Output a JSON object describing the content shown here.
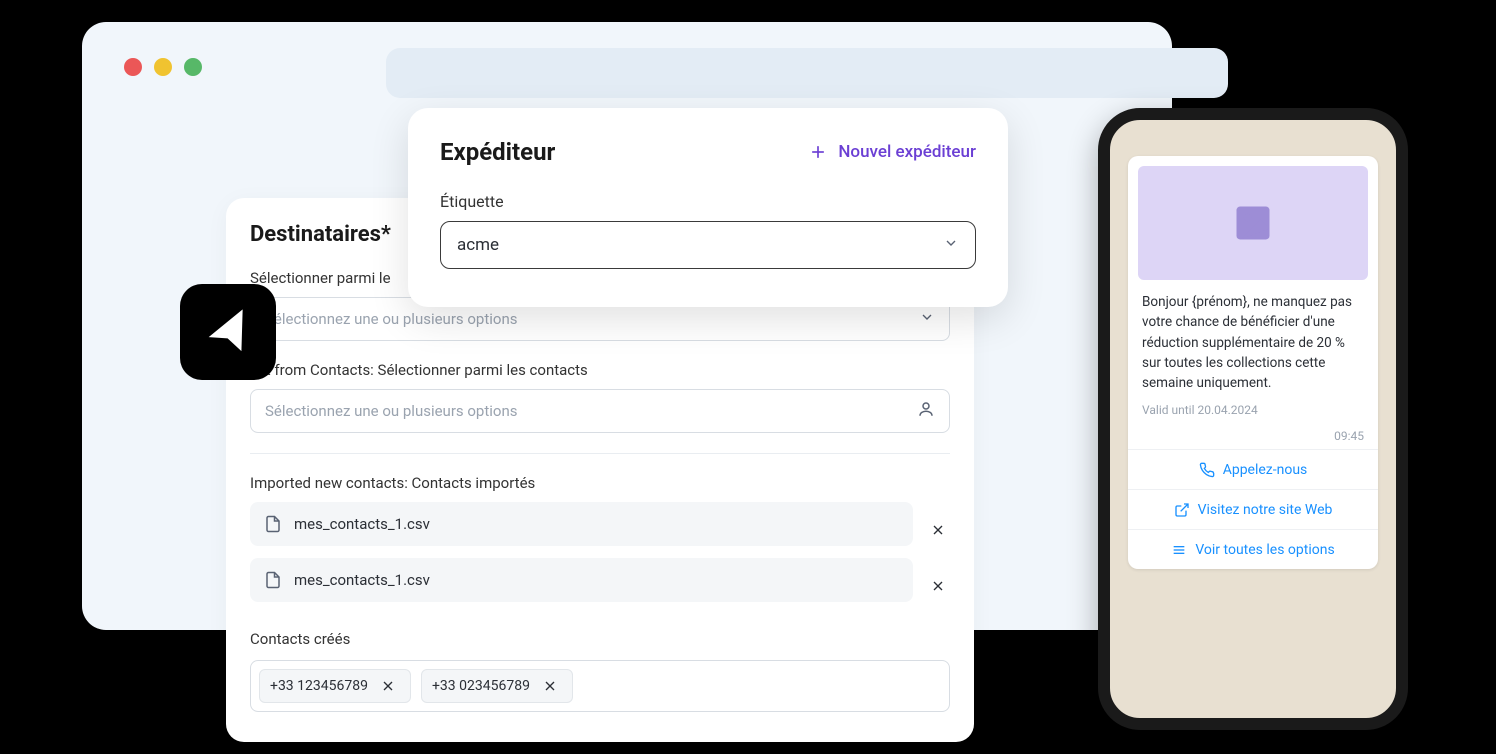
{
  "recipients": {
    "title": "Destinataires*",
    "select_label_1": "Sélectionner parmi le",
    "select_placeholder_1": "Sélectionnez une ou plusieurs options",
    "select_label_2": "ect from Contacts: Sélectionner parmi les contacts",
    "select_placeholder_2": "Sélectionnez une ou plusieurs options",
    "imported_label": "Imported new contacts: Contacts importés",
    "files": [
      "mes_contacts_1.csv",
      "mes_contacts_1.csv"
    ],
    "created_label": "Contacts créés",
    "phones": [
      "+33 123456789",
      "+33 023456789"
    ]
  },
  "sender": {
    "title": "Expéditeur",
    "new_label": "Nouvel expéditeur",
    "etiquette_label": "Étiquette",
    "etiquette_value": "acme"
  },
  "message": {
    "body": "Bonjour {prénom}, ne manquez pas votre chance de bénéficier d'une réduction supplémentaire de 20 % sur toutes les collections cette semaine uniquement.",
    "valid": "Valid until 20.04.2024",
    "time": "09:45",
    "action_call": "Appelez-nous",
    "action_visit": "Visitez notre site Web",
    "action_all": "Voir toutes les options"
  }
}
